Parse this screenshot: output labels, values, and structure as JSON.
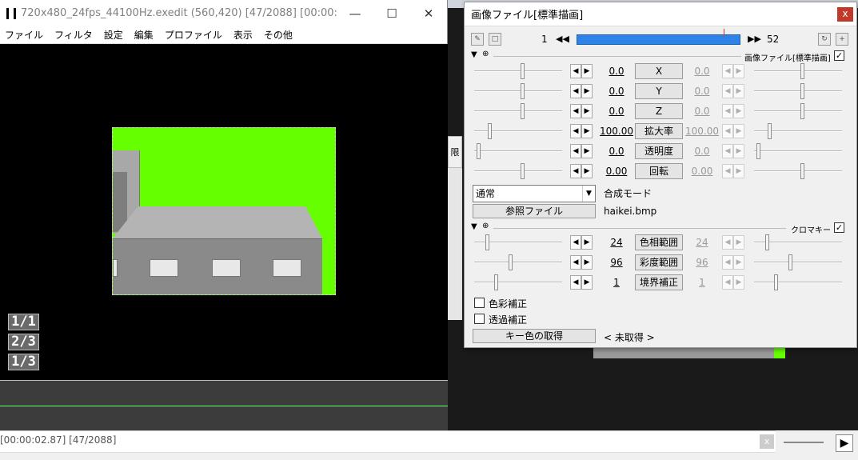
{
  "main_window": {
    "title": "720x480_24fps_44100Hz.exedit (560,420)  [47/2088] [00:00:02.",
    "controls": {
      "minimize": "—",
      "maximize": "☐",
      "close": "✕"
    },
    "menu": [
      "ファイル",
      "フィルタ",
      "設定",
      "編集",
      "プロファイル",
      "表示",
      "その他"
    ]
  },
  "frame_labels": [
    "1/1",
    "2/3",
    "1/3"
  ],
  "status_bar": {
    "text": "[00:00:02.87] [47/2088]"
  },
  "background_window": {
    "tab_char": "限",
    "play_icon": "▶"
  },
  "panel": {
    "title": "画像ファイル[標準描画]",
    "close_label": "x",
    "frame_start": "1",
    "frame_end": "52",
    "frame_position": 0.9,
    "sections": {
      "image": {
        "label": "画像ファイル[標準描画]",
        "checked": true
      },
      "chroma": {
        "label": "クロマキー",
        "checked": true
      }
    },
    "params": [
      {
        "name": "X",
        "value": "0.0",
        "end": "0.0",
        "left_pos": 0.55,
        "right_pos": 0.55
      },
      {
        "name": "Y",
        "value": "0.0",
        "end": "0.0",
        "left_pos": 0.55,
        "right_pos": 0.55
      },
      {
        "name": "Z",
        "value": "0.0",
        "end": "0.0",
        "left_pos": 0.55,
        "right_pos": 0.55
      },
      {
        "name": "拡大率",
        "value": "100.00",
        "end": "100.00",
        "left_pos": 0.18,
        "right_pos": 0.18
      },
      {
        "name": "透明度",
        "value": "0.0",
        "end": "0.0",
        "left_pos": 0.05,
        "right_pos": 0.05
      },
      {
        "name": "回転",
        "value": "0.00",
        "end": "0.00",
        "left_pos": 0.55,
        "right_pos": 0.55
      }
    ],
    "blend_mode": {
      "value": "通常",
      "label": "合成モード"
    },
    "ref_file": {
      "button": "参照ファイル",
      "filename": "haikei.bmp"
    },
    "chroma_params": [
      {
        "name": "色相範囲",
        "value": "24",
        "end": "24",
        "left_pos": 0.15,
        "right_pos": 0.15
      },
      {
        "name": "彩度範囲",
        "value": "96",
        "end": "96",
        "left_pos": 0.42,
        "right_pos": 0.42
      },
      {
        "name": "境界補正",
        "value": "1",
        "end": "1",
        "left_pos": 0.25,
        "right_pos": 0.25
      }
    ],
    "options": [
      {
        "label": "色彩補正",
        "checked": false
      },
      {
        "label": "透過補正",
        "checked": false
      }
    ],
    "key_color": {
      "button": "キー色の取得",
      "status": "< 未取得 >"
    }
  }
}
